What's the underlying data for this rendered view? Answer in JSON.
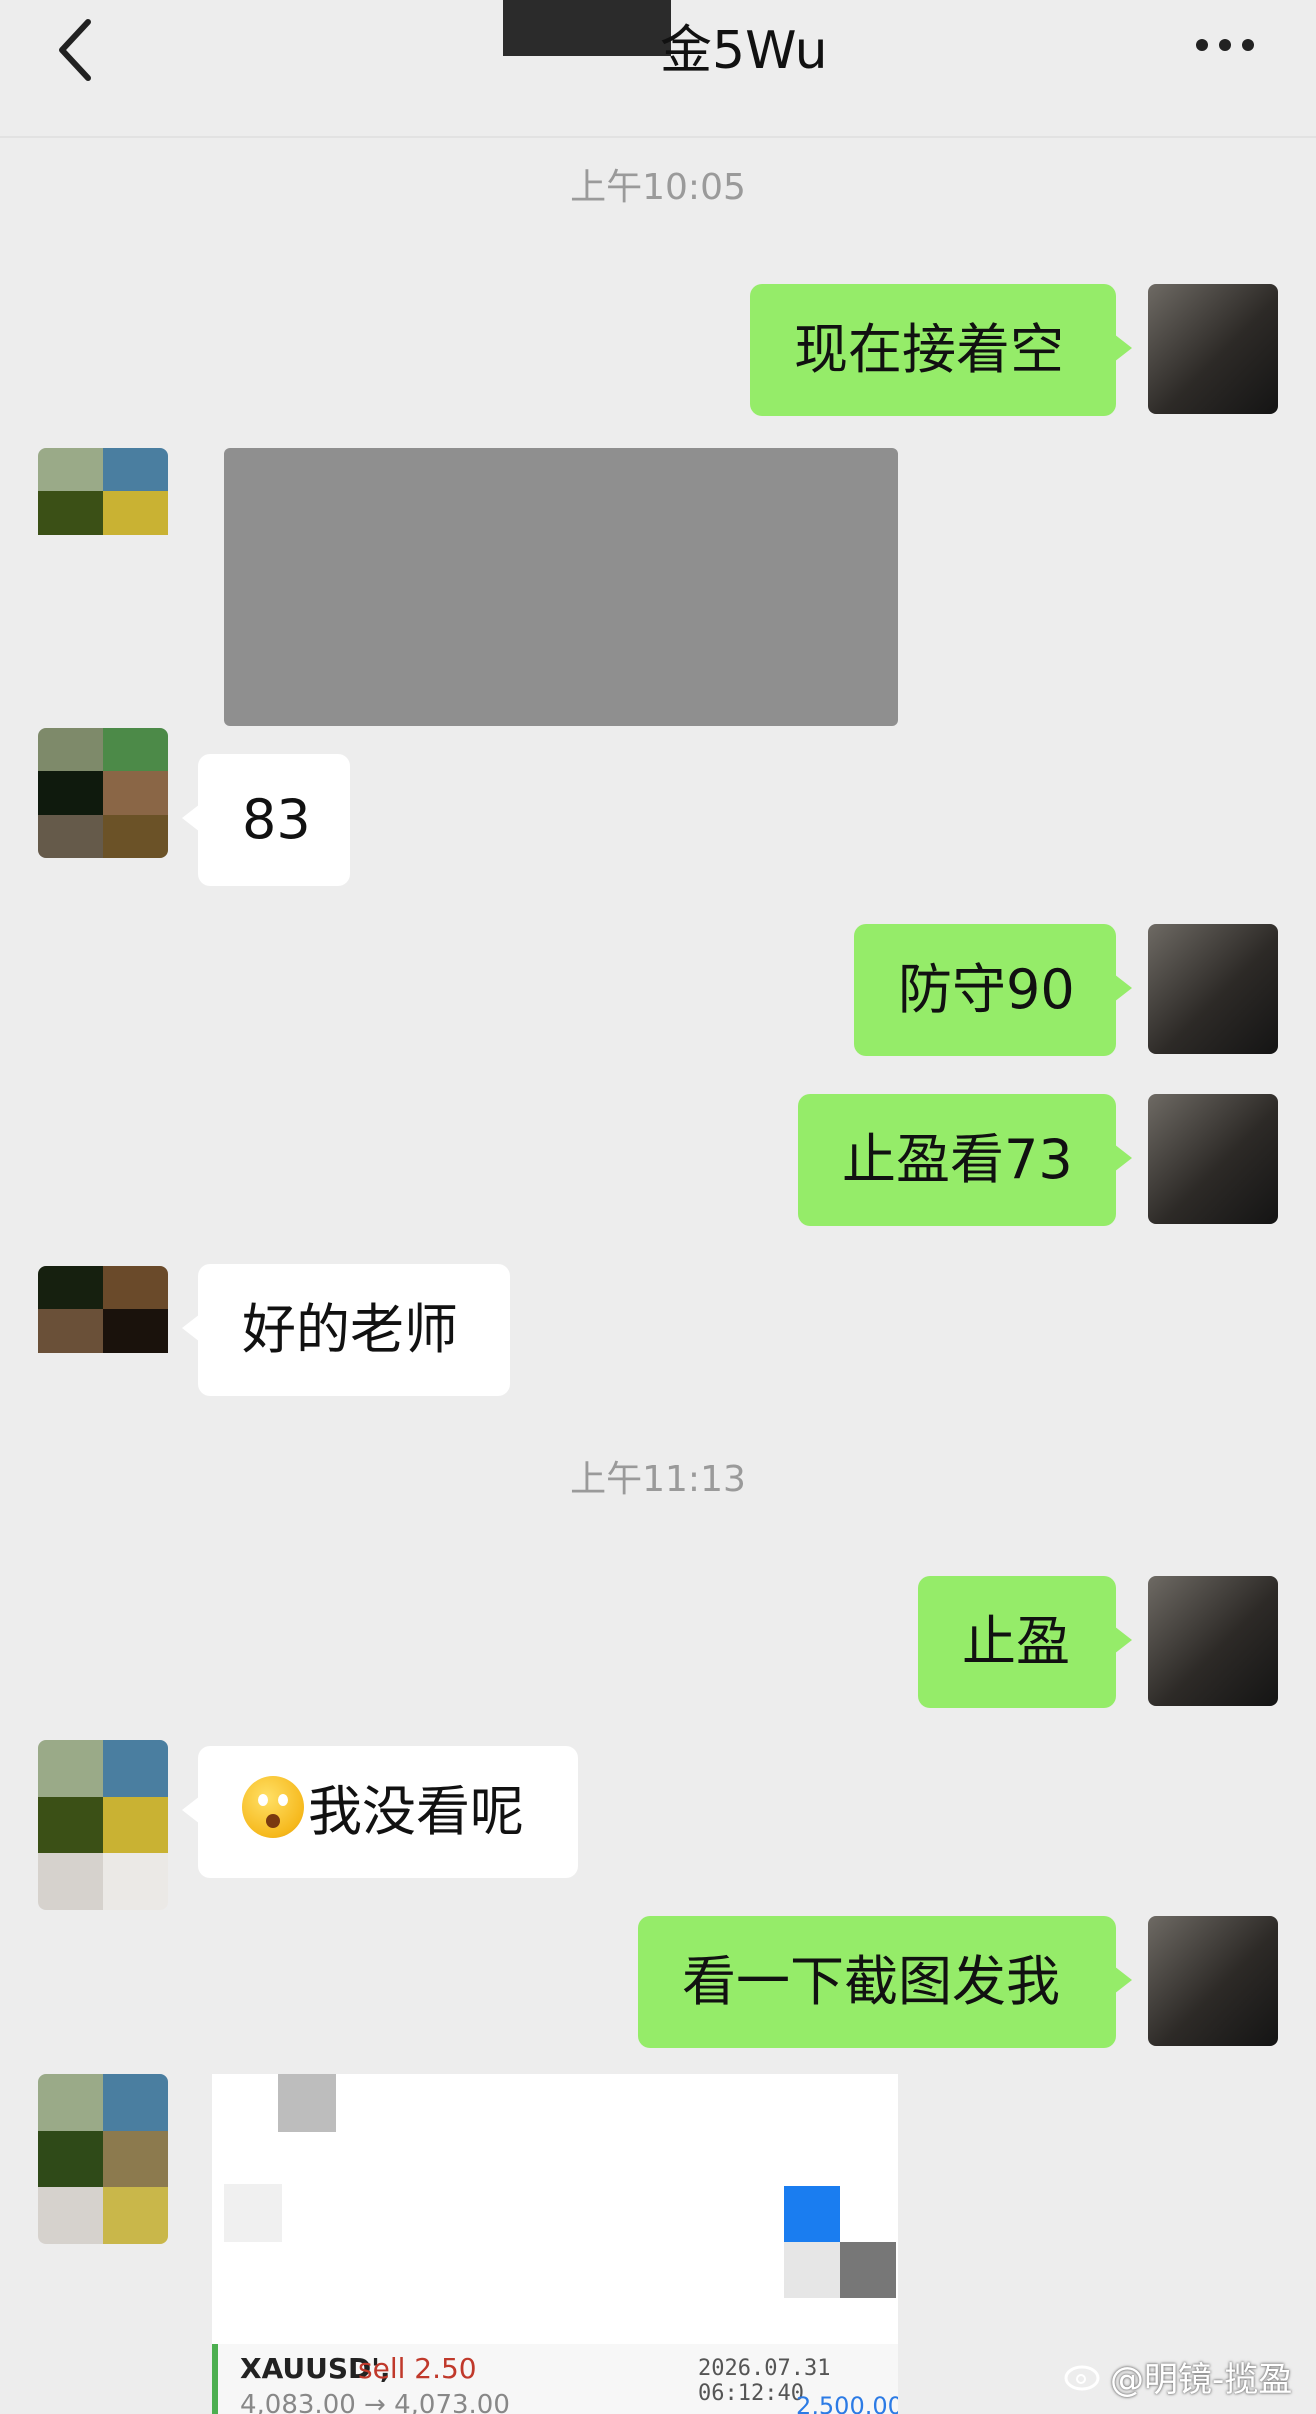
{
  "header": {
    "title": "金5Wu"
  },
  "timestamps": [
    "上午10:05",
    "上午11:13"
  ],
  "messages": {
    "m1": "现在接着空",
    "m2": "83",
    "m3": "防守90",
    "m4": "止盈看73",
    "m5": "好的老师",
    "m6": "止盈",
    "m7": "我没看呢",
    "m8": "看一下截图发我"
  },
  "trade_screenshot": {
    "symbol": "XAUUSD',",
    "side": "sell 2.50",
    "datetime": "2026.07.31 06:12:40",
    "price": "4,083.00 → 4,073.00",
    "profit": "2,500.00"
  },
  "watermark": "@明镜-揽盈",
  "colors": {
    "outgoing_bubble": "#95ec69",
    "incoming_bubble": "#ffffff",
    "background": "#ededed"
  },
  "icons": [
    "back-arrow-icon",
    "more-icon",
    "weibo-icon",
    "emoji-icon"
  ]
}
